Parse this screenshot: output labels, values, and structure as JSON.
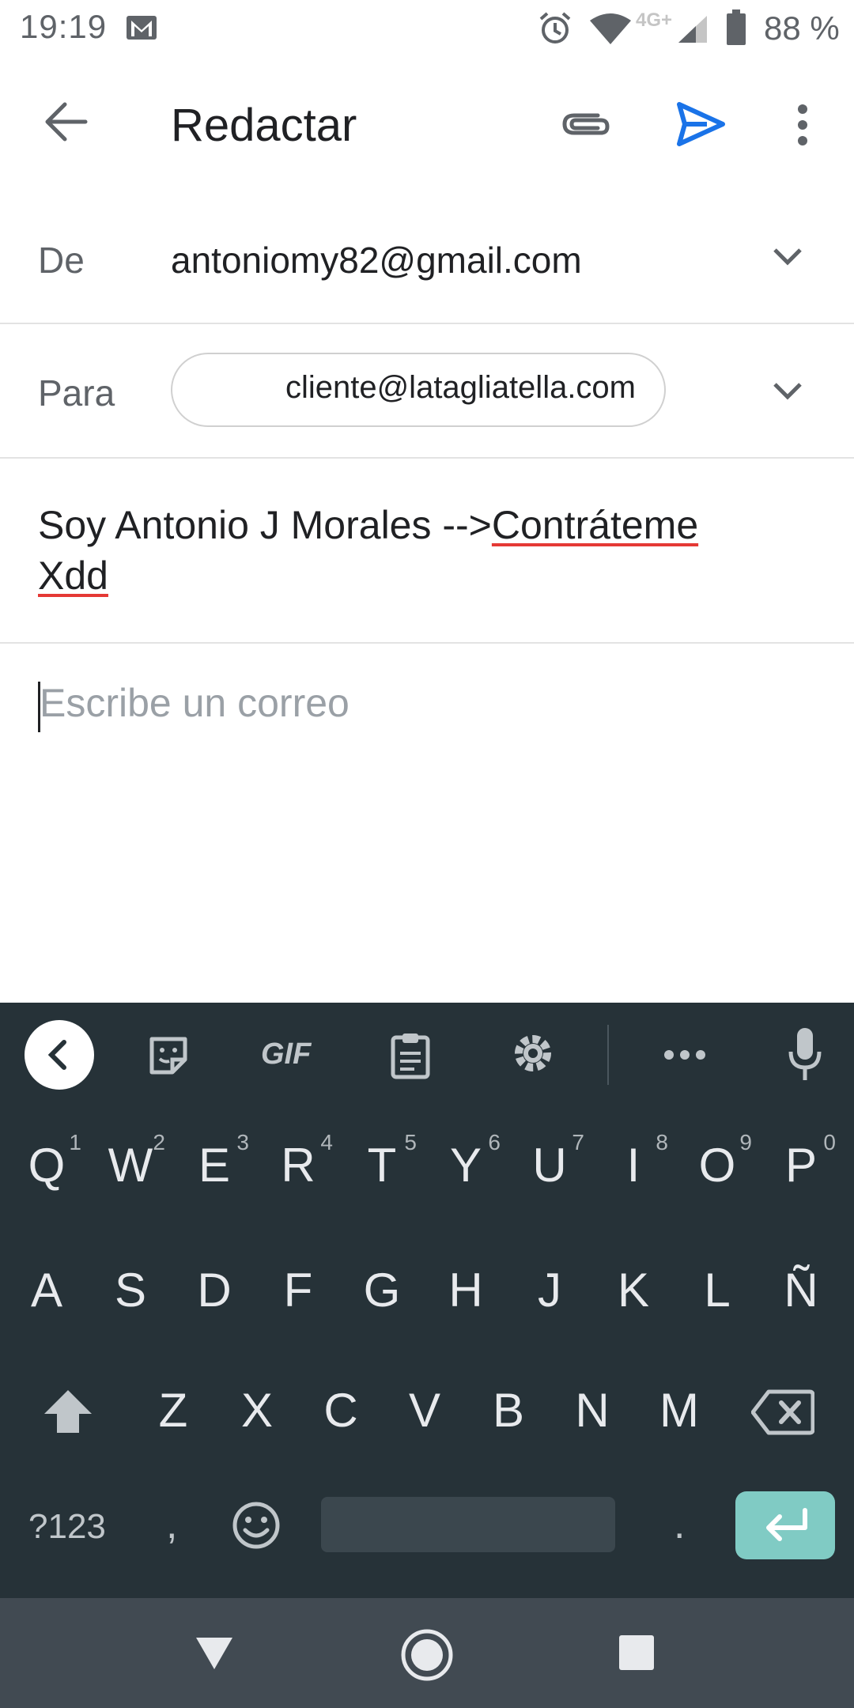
{
  "status_bar": {
    "time": "19:19",
    "network": "4G+",
    "battery": "88 %"
  },
  "app_bar": {
    "title": "Redactar"
  },
  "from": {
    "label": "De",
    "value": "antoniomy82@gmail.com"
  },
  "to": {
    "label": "Para",
    "chip": "cliente@latagliatella.com"
  },
  "subject": {
    "part1": " Soy Antonio J Morales -->",
    "part2": "Contráteme",
    "part3": "Xdd"
  },
  "body": {
    "placeholder": "Escribe un correo"
  },
  "keyboard": {
    "toolbar": {
      "gif": "GIF"
    },
    "row1": [
      {
        "k": "Q",
        "n": "1"
      },
      {
        "k": "W",
        "n": "2"
      },
      {
        "k": "E",
        "n": "3"
      },
      {
        "k": "R",
        "n": "4"
      },
      {
        "k": "T",
        "n": "5"
      },
      {
        "k": "Y",
        "n": "6"
      },
      {
        "k": "U",
        "n": "7"
      },
      {
        "k": "I",
        "n": "8"
      },
      {
        "k": "O",
        "n": "9"
      },
      {
        "k": "P",
        "n": "0"
      }
    ],
    "row2": [
      "A",
      "S",
      "D",
      "F",
      "G",
      "H",
      "J",
      "K",
      "L",
      "Ñ"
    ],
    "row3": [
      "Z",
      "X",
      "C",
      "V",
      "B",
      "N",
      "M"
    ],
    "row4": {
      "symbols": "?123",
      "comma": ",",
      "period": "."
    }
  },
  "colors": {
    "accent": "#1a73e8",
    "keyboard_bg": "#263238",
    "enter": "#80cbc4"
  }
}
